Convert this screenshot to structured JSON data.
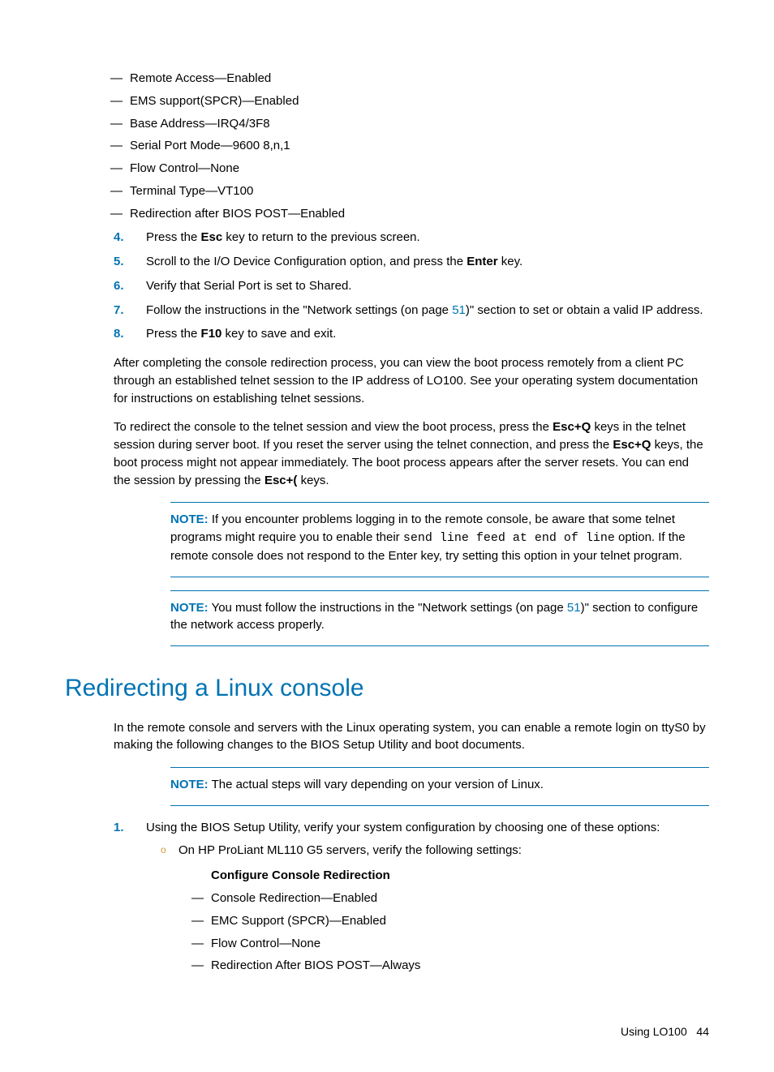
{
  "settings1": [
    "Remote Access—Enabled",
    "EMS support(SPCR)—Enabled",
    "Base Address—IRQ4/3F8",
    "Serial Port Mode—9600 8,n,1",
    "Flow Control—None",
    "Terminal Type—VT100",
    "Redirection after BIOS POST—Enabled"
  ],
  "step4": {
    "pre": "Press the ",
    "bold": "Esc",
    "post": " key to return to the previous screen."
  },
  "step5": {
    "pre": "Scroll to the I/O Device Configuration option, and press the ",
    "bold": "Enter",
    "post": " key."
  },
  "step6": "Verify that Serial Port is set to Shared.",
  "step7": {
    "pre": "Follow the instructions in the \"Network settings (on page ",
    "link": "51",
    "post": ")\" section to set or obtain a valid IP address."
  },
  "step8": {
    "pre": "Press the ",
    "bold": "F10",
    "post": " key to save and exit."
  },
  "para1": "After completing the console redirection process, you can view the boot process remotely from a client PC through an established telnet session to the IP address of LO100. See your operating system documentation for instructions on establishing telnet sessions.",
  "para2": {
    "a": "To redirect the console to the telnet session and view the boot process, press the ",
    "b1": "Esc+Q",
    "b": " keys in the telnet session during server boot. If you reset the server using the telnet connection, and press the ",
    "b2": "Esc+Q",
    "c": " keys, the boot process might not appear immediately. The boot process appears after the server resets. You can end the session by pressing the ",
    "b3": "Esc+(",
    "d": " keys."
  },
  "note_label": "NOTE:",
  "note1": {
    "a": "If you encounter problems logging in to the remote console, be aware that some telnet programs might require you to enable their ",
    "mono": "send line feed at end of line",
    "b": " option. If the remote console does not respond to the Enter key, try setting this option in your telnet program."
  },
  "note2": {
    "a": "You must follow the instructions in the \"Network settings (on page ",
    "link": "51",
    "b": ")\" section to configure the network access properly."
  },
  "heading": "Redirecting a Linux console",
  "linux_intro": "In the remote console and servers with the Linux operating system, you can enable a remote login on ttyS0 by making the following changes to the BIOS Setup Utility and boot documents.",
  "note3": "The actual steps will vary depending on your version of Linux.",
  "lstep1": "Using the BIOS Setup Utility, verify your system configuration by choosing one of these options:",
  "lsub1": "On HP ProLiant ML110 G5 servers, verify the following settings:",
  "configure_heading": "Configure Console Redirection",
  "settings2": [
    "Console Redirection—Enabled",
    "EMC Support (SPCR)—Enabled",
    "Flow Control—None",
    "Redirection After BIOS POST—Always"
  ],
  "footer": {
    "text": "Using LO100",
    "page": "44"
  },
  "nums": {
    "n4": "4.",
    "n5": "5.",
    "n6": "6.",
    "n7": "7.",
    "n8": "8.",
    "n1": "1."
  }
}
